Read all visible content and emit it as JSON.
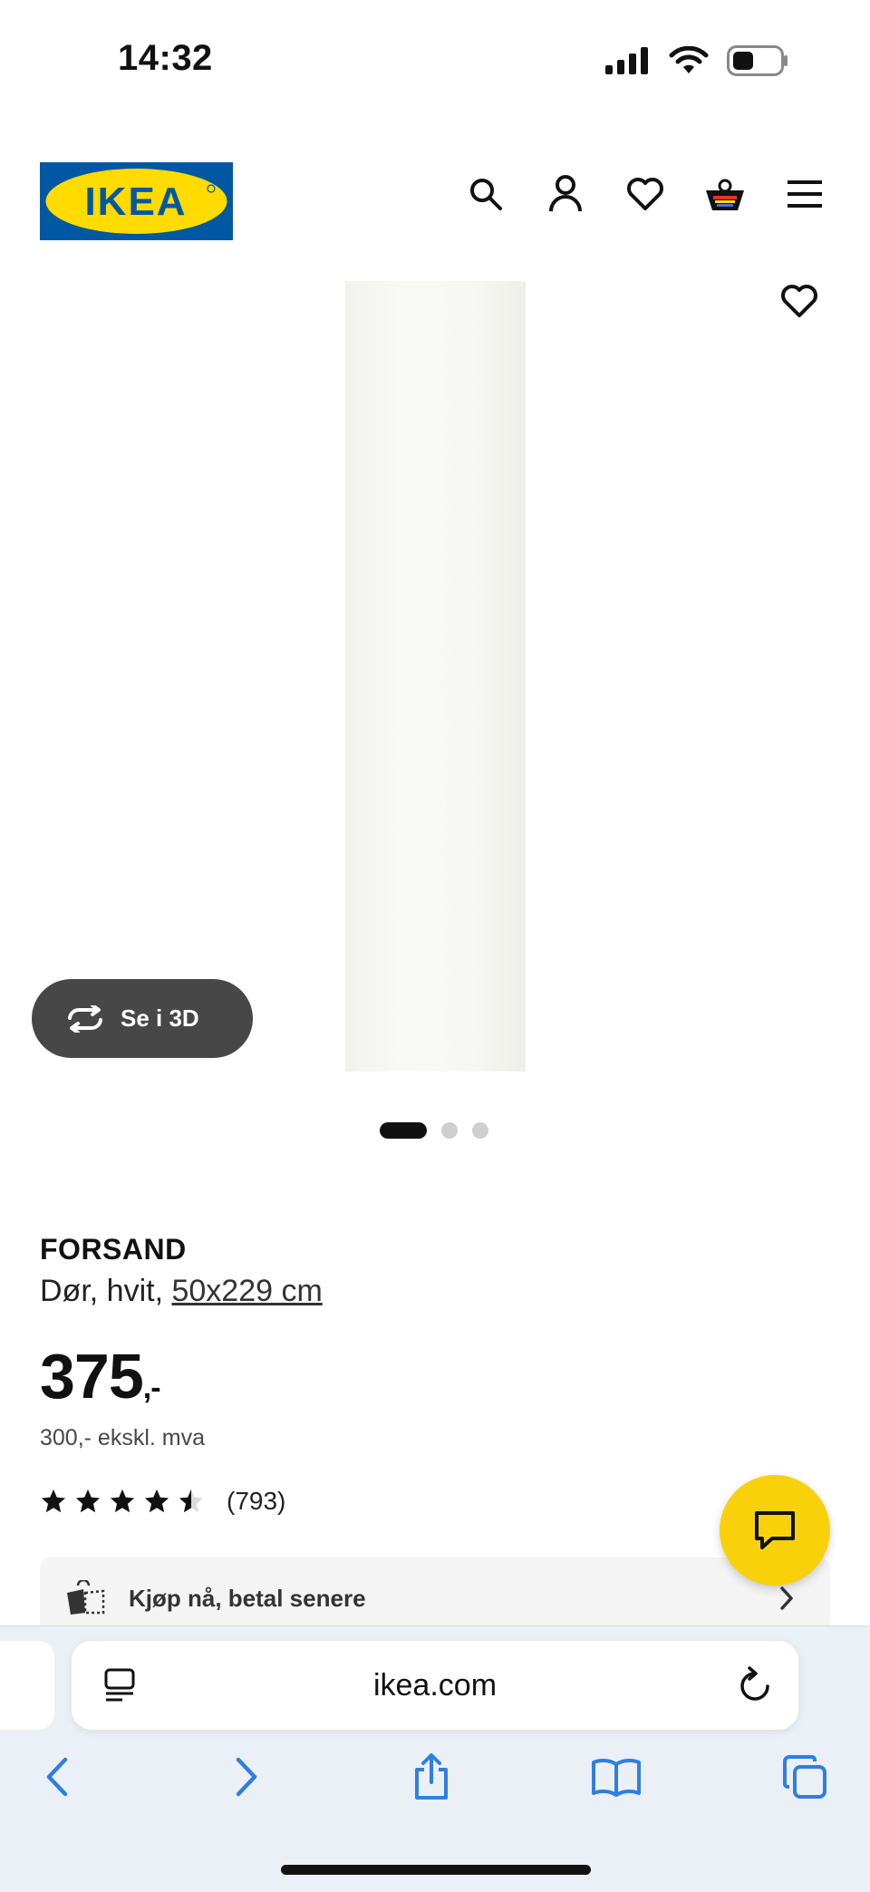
{
  "status_bar": {
    "time": "14:32"
  },
  "header": {
    "logo_text": "IKEA",
    "icons": [
      "search-icon",
      "account-icon",
      "heart-icon",
      "basket-icon",
      "menu-icon"
    ]
  },
  "gallery": {
    "view_3d_label": "Se i 3D",
    "pages": 3,
    "active_page": 1
  },
  "product": {
    "name": "FORSAND",
    "description_prefix": "Dør, hvit, ",
    "size_link": "50x229 cm",
    "price": "375",
    "price_suffix": ",-",
    "price_ex_vat": "300,- ekskl. mva",
    "rating_value": 4.5,
    "rating_count": "(793)"
  },
  "payment_banner": {
    "label": "Kjøp nå, betal senere"
  },
  "browser": {
    "url": "ikea.com"
  },
  "colors": {
    "ikea_blue": "#0058a3",
    "ikea_yellow": "#ffdb00",
    "chat_yellow": "#f9d10b",
    "safari_blue": "#2f7fe0"
  }
}
